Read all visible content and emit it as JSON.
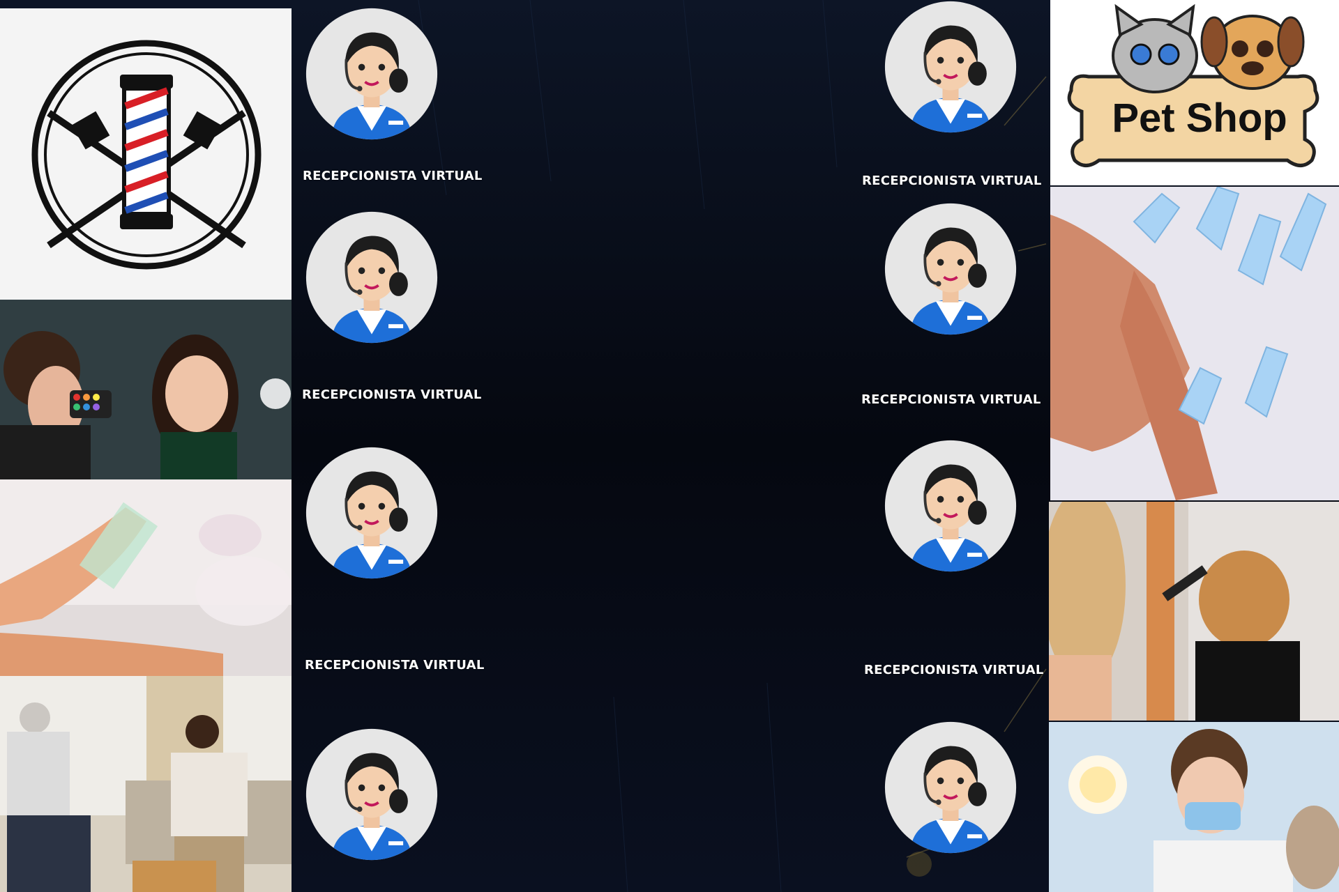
{
  "receptionist_label": "RECEPCIONISTA VIRTUAL",
  "labels_left": [
    "RECEPCIONISTA VIRTUAL",
    "RECEPCIONISTA VIRTUAL",
    "RECEPCIONISTA VIRTUAL"
  ],
  "labels_right": [
    "RECEPCIONISTA VIRTUAL",
    "RECEPCIONISTA VIRTUAL",
    "RECEPCIONISTA VIRTUAL"
  ],
  "pet_shop_text": "Pet Shop",
  "icons": [
    "barber-pole-logo",
    "pet-shop-logo",
    "receptionist-avatar-icon"
  ],
  "colors": {
    "background": "#060b16",
    "label": "#ffffff",
    "uniform": "#1e6fd8",
    "bone": "#f3d5a3"
  }
}
